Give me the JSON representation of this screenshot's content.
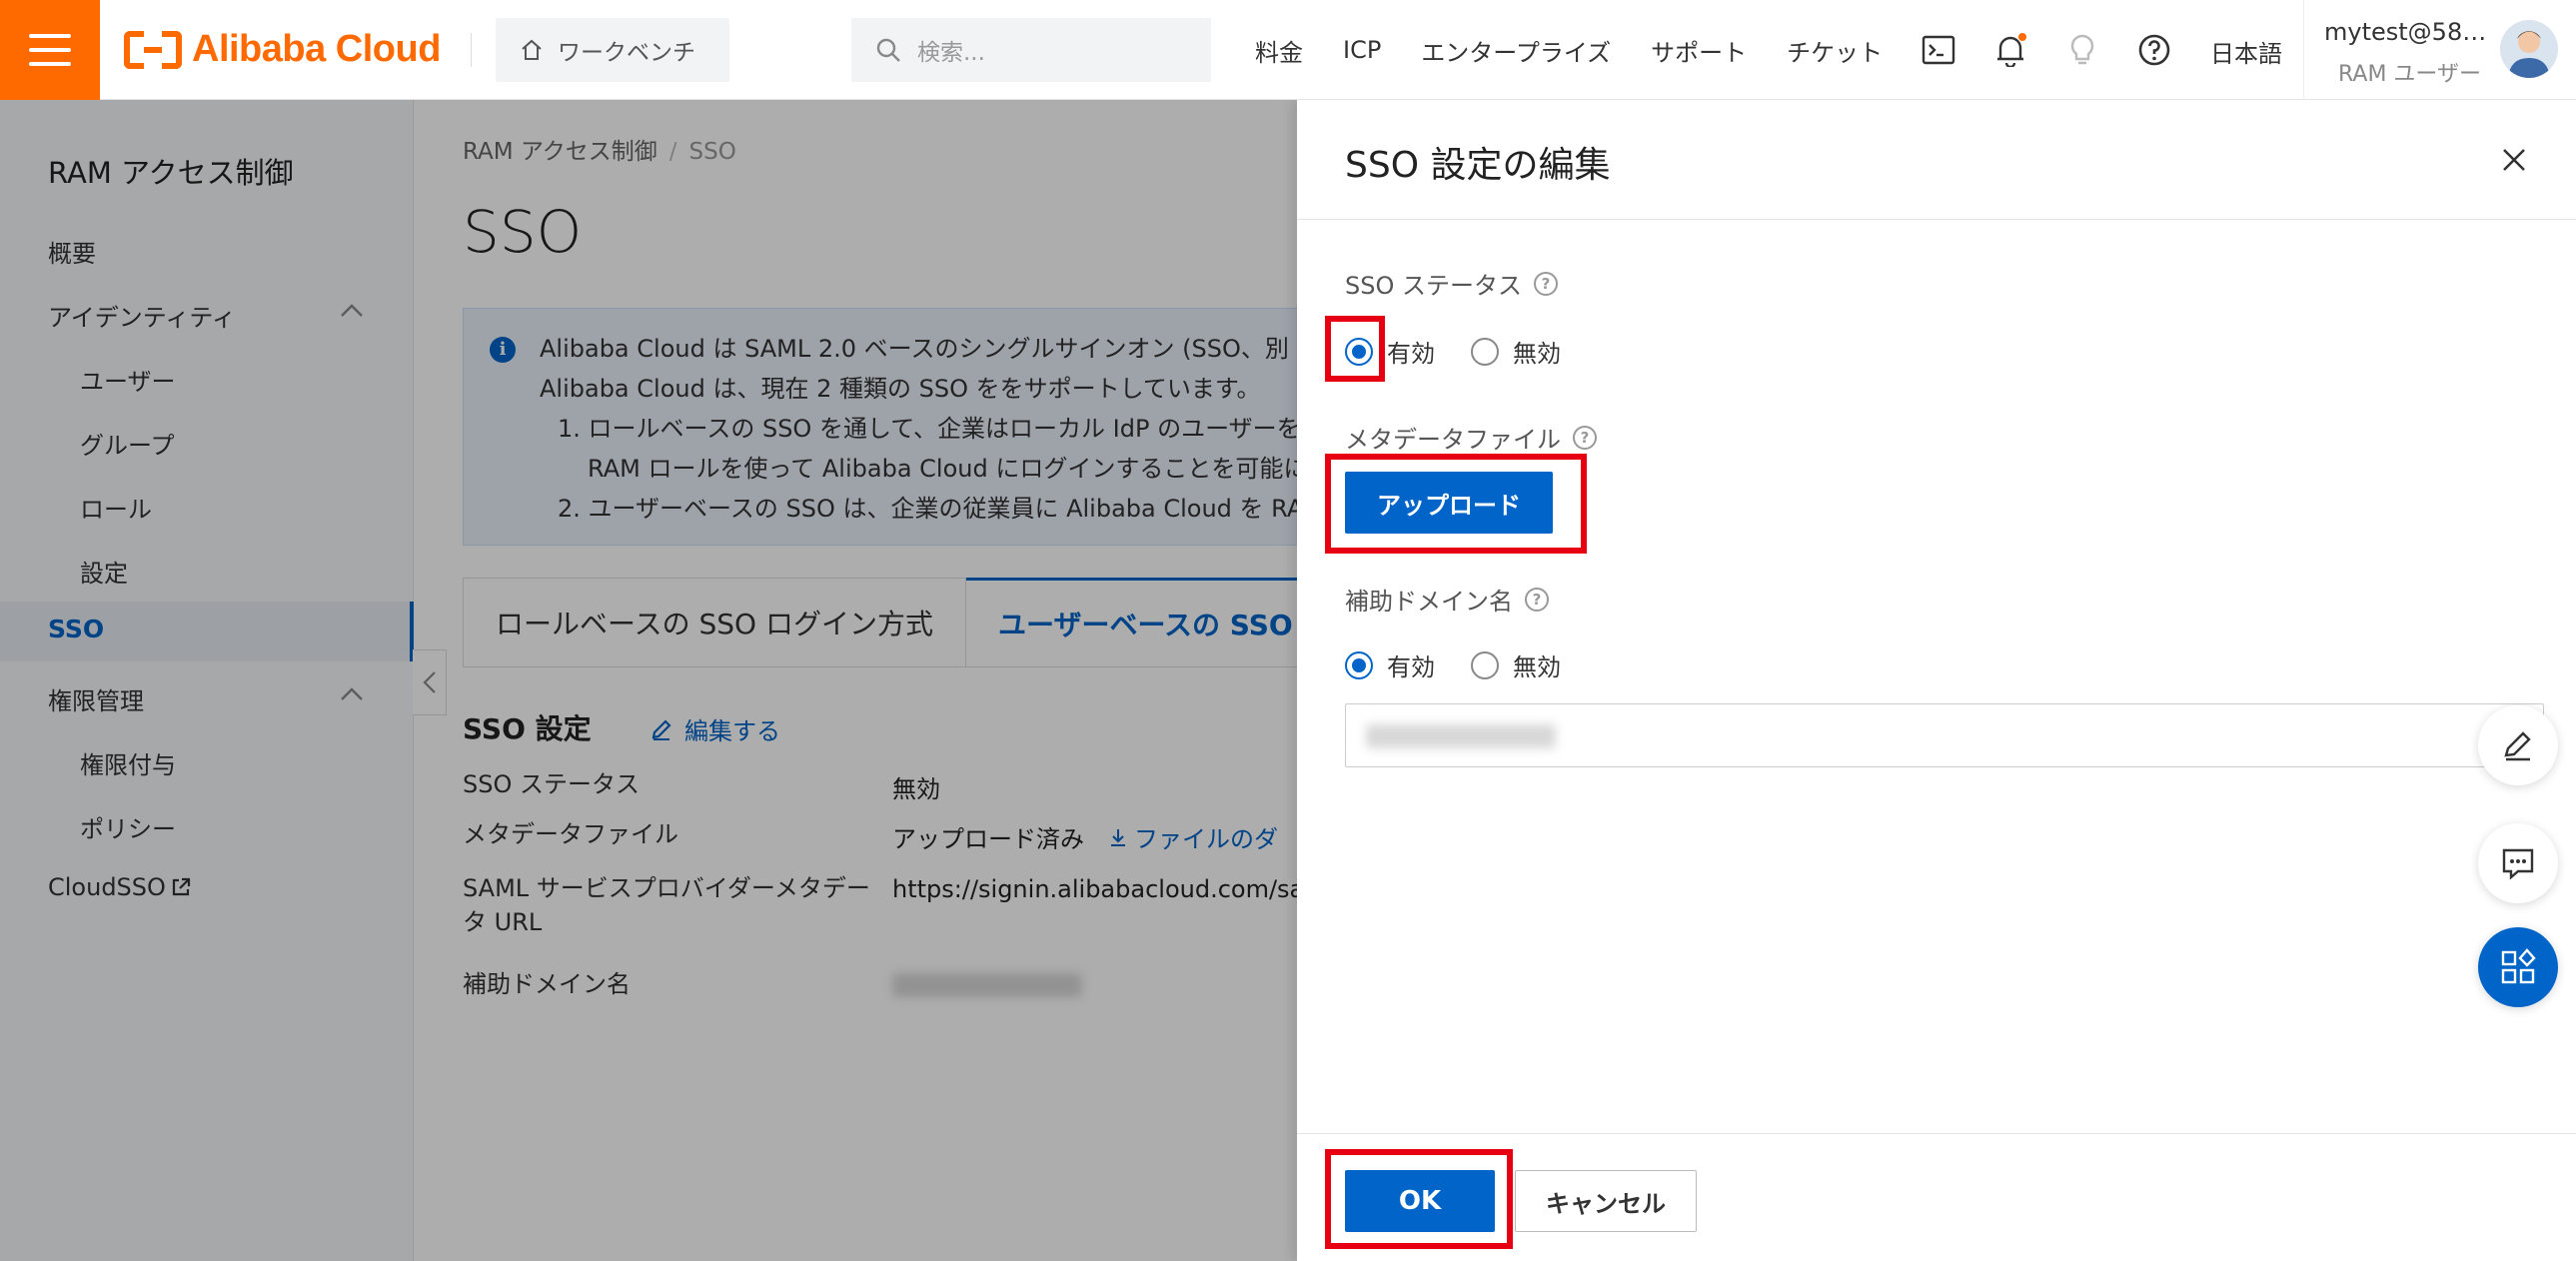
{
  "topbar": {
    "brand": "Alibaba Cloud",
    "workbench": "ワークベンチ",
    "search_placeholder": "検索...",
    "nav": [
      "料金",
      "ICP",
      "エンタープライズ",
      "サポート",
      "チケット"
    ],
    "language": "日本語",
    "user_name": "mytest@58…",
    "user_role": "RAM ユーザー",
    "notification_dot_color": "#ff6a00"
  },
  "sidebar": {
    "title": "RAM アクセス制御",
    "overview": "概要",
    "identity": "アイデンティティ",
    "users": "ユーザー",
    "groups": "グループ",
    "roles": "ロール",
    "settings": "設定",
    "sso": "SSO",
    "permissions": "権限管理",
    "grants": "権限付与",
    "policies": "ポリシー",
    "cloudsso": "CloudSSO"
  },
  "main": {
    "breadcrumb_root": "RAM アクセス制御",
    "breadcrumb_sep": "/",
    "breadcrumb_current": "SSO",
    "title": "SSO",
    "info_line1": "Alibaba Cloud は SAML 2.0 ベースのシングルサインオン (SSO、別",
    "info_line2": "Alibaba Cloud は、現在 2 種類の SSO ををサポートしています。",
    "info_line3": "1. ロールベースの SSO を通して、企業はローカル IdP のユーザーを",
    "info_line4": "RAM ロールを使って Alibaba Cloud にログインすることを可能に",
    "info_line5": "2. ユーザーベースの SSO は、企業の従業員に Alibaba Cloud を RA",
    "tab_role": "ロールベースの SSO ログイン方式",
    "tab_user": "ユーザーベースの SSO",
    "section_title": "SSO 設定",
    "edit": "編集する",
    "status_label": "SSO ステータス",
    "status_value": "無効",
    "metadata_label": "メタデータファイル",
    "metadata_value": "アップロード済み",
    "download_link": "ファイルのダ",
    "saml_label": "SAML サービスプロバイダーメタデータ URL",
    "saml_value": "https://signin.alibabacloud.com/sa",
    "domain_label": "補助ドメイン名"
  },
  "drawer": {
    "title": "SSO 設定の編集",
    "sso_status_label": "SSO ステータス",
    "enabled": "有効",
    "disabled": "無効",
    "sso_status_selected": "有効",
    "metadata_label": "メタデータファイル",
    "upload": "アップロード",
    "domain_label": "補助ドメイン名",
    "domain_selected": "有効",
    "ok": "OK",
    "cancel": "キャンセル"
  },
  "colors": {
    "brand_orange": "#ff6a00",
    "primary_blue": "#0064c8",
    "highlight_red": "#e60012"
  }
}
